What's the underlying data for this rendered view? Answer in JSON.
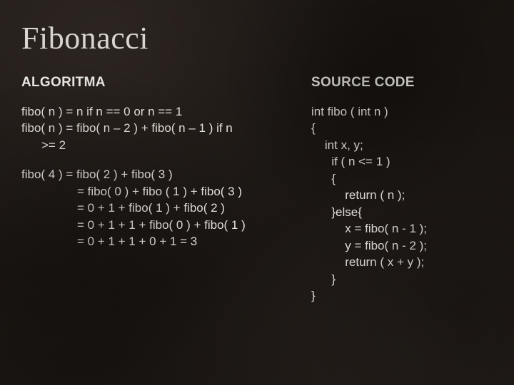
{
  "title": "Fibonacci",
  "left": {
    "heading": "ALGORITMA",
    "rule1_a": "fibo( n ) = n if n == 0 or n == 1",
    "rule2_a": "fibo( n ) = fibo( n – 2 ) + fibo( n – 1 ) if n",
    "rule2_b": ">= 2",
    "ex1": "fibo( 4 ) = fibo( 2 ) + fibo( 3 )",
    "ex2": "= fibo( 0 ) + fibo ( 1 ) + fibo( 3 )",
    "ex3": "= 0 + 1 + fibo( 1 ) + fibo( 2 )",
    "ex4": "= 0 + 1 + 1 + fibo( 0 ) + fibo( 1 )",
    "ex5": "= 0 + 1 + 1 + 0 + 1 = 3"
  },
  "right": {
    "heading": "SOURCE CODE",
    "code": "int fibo ( int n )\n{\n    int x, y;\n      if ( n <= 1 )\n      {\n          return ( n );\n      }else{\n          x = fibo( n - 1 );\n          y = fibo( n - 2 );\n          return ( x + y );\n      }\n}"
  }
}
